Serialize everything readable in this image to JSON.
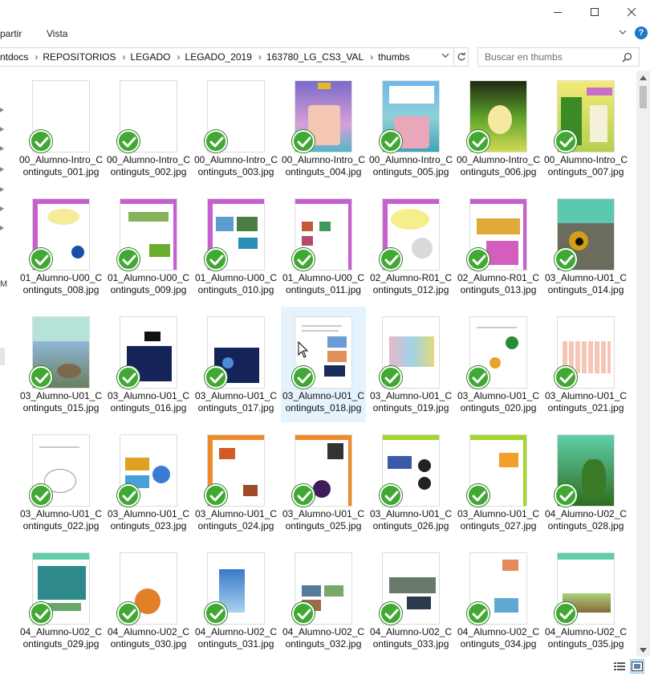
{
  "window": {
    "min_icon": "minimize-icon",
    "max_icon": "maximize-icon",
    "close_icon": "close-icon"
  },
  "ribbon": {
    "tab_share": "partir",
    "tab_view": "Vista",
    "help_glyph": "?"
  },
  "address": {
    "crumbs": [
      "ntdocs",
      "REPOSITORIOS",
      "LEGADO",
      "LEGADO_2019",
      "163780_LG_CS3_VAL",
      "thumbs"
    ]
  },
  "search": {
    "placeholder": "Buscar en thumbs"
  },
  "navpane": {
    "partial_letter": "M"
  },
  "colors": {
    "accent": "#1e74c9",
    "check_green": "#41a833",
    "selection": "#e5f3ff"
  },
  "files": [
    {
      "name": "00_Alumno-Intro_Continguts_001.jpg",
      "art": "blank"
    },
    {
      "name": "00_Alumno-Intro_Continguts_002.jpg",
      "art": "blank"
    },
    {
      "name": "00_Alumno-Intro_Continguts_003.jpg",
      "art": "blank"
    },
    {
      "name": "00_Alumno-Intro_Continguts_004.jpg",
      "art": "castle"
    },
    {
      "name": "00_Alumno-Intro_Continguts_005.jpg",
      "art": "castle2"
    },
    {
      "name": "00_Alumno-Intro_Continguts_006.jpg",
      "art": "green"
    },
    {
      "name": "00_Alumno-Intro_Continguts_007.jpg",
      "art": "green2"
    },
    {
      "name": "01_Alumno-U00_Continguts_008.jpg",
      "art": "purple"
    },
    {
      "name": "01_Alumno-U00_Continguts_009.jpg",
      "art": "purple2"
    },
    {
      "name": "01_Alumno-U00_Continguts_010.jpg",
      "art": "purple3"
    },
    {
      "name": "01_Alumno-U00_Continguts_011.jpg",
      "art": "purple4"
    },
    {
      "name": "02_Alumno-R01_Continguts_012.jpg",
      "art": "purple5"
    },
    {
      "name": "02_Alumno-R01_Continguts_013.jpg",
      "art": "purple6"
    },
    {
      "name": "03_Alumno-U01_Continguts_014.jpg",
      "art": "owl"
    },
    {
      "name": "03_Alumno-U01_Continguts_015.jpg",
      "art": "photo"
    },
    {
      "name": "03_Alumno-U01_Continguts_016.jpg",
      "art": "space"
    },
    {
      "name": "03_Alumno-U01_Continguts_017.jpg",
      "art": "space2"
    },
    {
      "name": "03_Alumno-U01_Continguts_018.jpg",
      "art": "text"
    },
    {
      "name": "03_Alumno-U01_Continguts_019.jpg",
      "art": "map"
    },
    {
      "name": "03_Alumno-U01_Continguts_020.jpg",
      "art": "text2"
    },
    {
      "name": "03_Alumno-U01_Continguts_021.jpg",
      "art": "table"
    },
    {
      "name": "03_Alumno-U01_Continguts_022.jpg",
      "art": "text3"
    },
    {
      "name": "03_Alumno-U01_Continguts_023.jpg",
      "art": "sun"
    },
    {
      "name": "03_Alumno-U01_Continguts_024.jpg",
      "art": "orange"
    },
    {
      "name": "03_Alumno-U01_Continguts_025.jpg",
      "art": "orange2"
    },
    {
      "name": "03_Alumno-U01_Continguts_026.jpg",
      "art": "lime"
    },
    {
      "name": "03_Alumno-U01_Continguts_027.jpg",
      "art": "lime2"
    },
    {
      "name": "04_Alumno-U02_Continguts_028.jpg",
      "art": "forest"
    },
    {
      "name": "04_Alumno-U02_Continguts_029.jpg",
      "art": "sat"
    },
    {
      "name": "04_Alumno-U02_Continguts_030.jpg",
      "art": "globe"
    },
    {
      "name": "04_Alumno-U02_Continguts_031.jpg",
      "art": "sky"
    },
    {
      "name": "04_Alumno-U02_Continguts_032.jpg",
      "art": "text4"
    },
    {
      "name": "04_Alumno-U02_Continguts_033.jpg",
      "art": "text5"
    },
    {
      "name": "04_Alumno-U02_Continguts_034.jpg",
      "art": "text6"
    },
    {
      "name": "04_Alumno-U02_Continguts_035.jpg",
      "art": "layers"
    }
  ],
  "selected_index": 17
}
